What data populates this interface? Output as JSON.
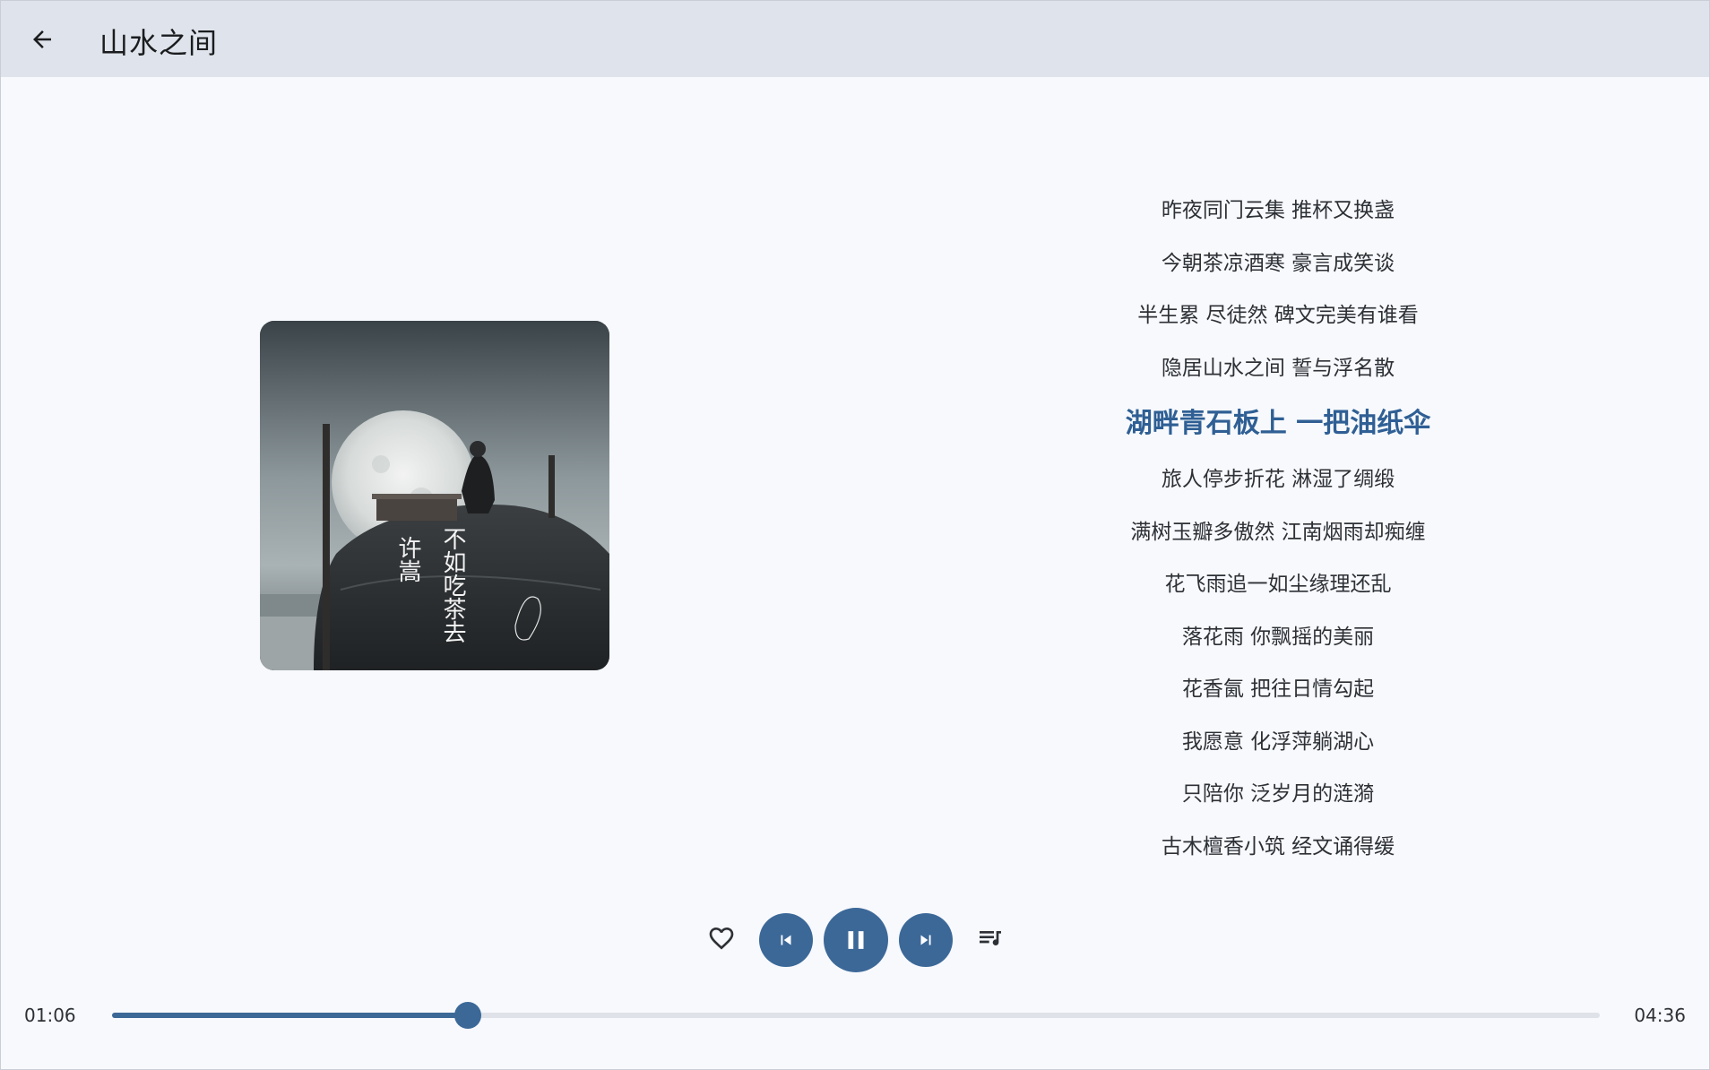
{
  "header": {
    "back_icon": "arrow-left-icon",
    "title": "山水之间"
  },
  "album": {
    "artist_text": "许嵩",
    "album_title_text": "不如吃茶去",
    "description": "album-cover"
  },
  "lyrics": {
    "active_index": 4,
    "lines": [
      "昨夜同门云集 推杯又换盏",
      "今朝茶凉酒寒 豪言成笑谈",
      "半生累 尽徒然 碑文完美有谁看",
      "隐居山水之间 誓与浮名散",
      "湖畔青石板上 一把油纸伞",
      "旅人停步折花 淋湿了绸缎",
      "满树玉瓣多傲然 江南烟雨却痴缠",
      "花飞雨追一如尘缘理还乱",
      "落花雨 你飘摇的美丽",
      "花香氤 把往日情勾起",
      "我愿意 化浮萍躺湖心",
      "只陪你 泛岁月的涟漪",
      "古木檀香小筑 经文诵得缓"
    ]
  },
  "controls": {
    "favorite_icon": "heart-outline-icon",
    "previous_icon": "skip-previous-icon",
    "play_pause_icon": "pause-icon",
    "next_icon": "skip-next-icon",
    "queue_icon": "playlist-music-icon"
  },
  "progress": {
    "current_time": "01:06",
    "total_time": "04:36",
    "fraction": 0.2391
  },
  "colors": {
    "accent": "#3c6898",
    "active_lyric": "#2f5f94",
    "topbar": "#dfe3eb",
    "background": "#f7f9fd"
  }
}
